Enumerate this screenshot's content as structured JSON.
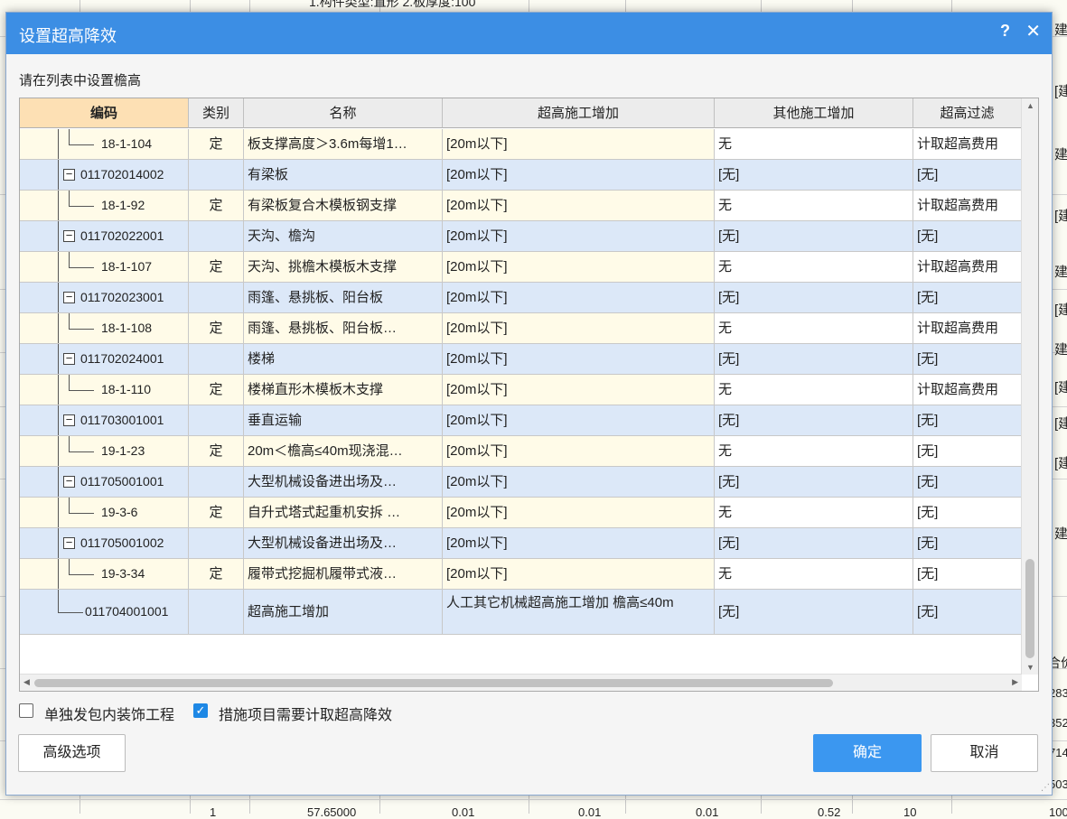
{
  "background": {
    "top_text": "1.构件类型:直形 2.板厚度:100",
    "right_column": [
      "建",
      "[建",
      "建",
      "[建",
      "建",
      "[建",
      "建",
      "[建",
      "[建",
      "[建",
      "建"
    ],
    "price_label": "合价",
    "price_values": [
      "283",
      "352",
      "714",
      "503",
      "100"
    ],
    "bottom_values": [
      "1",
      "57.65000",
      "0.01",
      "0.01",
      "0.01",
      "0.52",
      "10"
    ]
  },
  "dialog": {
    "title": "设置超高降效",
    "help_label": "?",
    "close_label": "✕",
    "instruction": "请在列表中设置檐高",
    "columns": [
      "编码",
      "类别",
      "名称",
      "超高施工增加",
      "其他施工增加",
      "超高过滤"
    ],
    "rows": [
      {
        "type": "quota",
        "code": "18-1-104",
        "category": "定",
        "name": "板支撑高度＞3.6m每增1…",
        "super": "[20m以下]",
        "other": "无",
        "filter": "计取超高费用"
      },
      {
        "type": "bill",
        "code": "011702014002",
        "category": "",
        "name": "有梁板",
        "super": "[20m以下]",
        "other": "[无]",
        "filter": "[无]"
      },
      {
        "type": "quota",
        "code": "18-1-92",
        "category": "定",
        "name": "有梁板复合木模板钢支撑",
        "super": "[20m以下]",
        "other": "无",
        "filter": "计取超高费用"
      },
      {
        "type": "bill",
        "code": "011702022001",
        "category": "",
        "name": "天沟、檐沟",
        "super": "[20m以下]",
        "other": "[无]",
        "filter": "[无]"
      },
      {
        "type": "quota",
        "code": "18-1-107",
        "category": "定",
        "name": "天沟、挑檐木模板木支撑",
        "super": "[20m以下]",
        "other": "无",
        "filter": "计取超高费用"
      },
      {
        "type": "bill",
        "code": "011702023001",
        "category": "",
        "name": "雨篷、悬挑板、阳台板",
        "super": "[20m以下]",
        "other": "[无]",
        "filter": "[无]"
      },
      {
        "type": "quota",
        "code": "18-1-108",
        "category": "定",
        "name": "雨篷、悬挑板、阳台板…",
        "super": "[20m以下]",
        "other": "无",
        "filter": "计取超高费用"
      },
      {
        "type": "bill",
        "code": "011702024001",
        "category": "",
        "name": "楼梯",
        "super": "[20m以下]",
        "other": "[无]",
        "filter": "[无]"
      },
      {
        "type": "quota",
        "code": "18-1-110",
        "category": "定",
        "name": "楼梯直形木模板木支撑",
        "super": "[20m以下]",
        "other": "无",
        "filter": "计取超高费用"
      },
      {
        "type": "bill",
        "code": "011703001001",
        "category": "",
        "name": "垂直运输",
        "super": "[20m以下]",
        "other": "[无]",
        "filter": "[无]"
      },
      {
        "type": "quota",
        "code": "19-1-23",
        "category": "定",
        "name": "20m＜檐高≤40m现浇混…",
        "super": "[20m以下]",
        "other": "无",
        "filter": "[无]"
      },
      {
        "type": "bill",
        "code": "011705001001",
        "category": "",
        "name": "大型机械设备进出场及…",
        "super": "[20m以下]",
        "other": "[无]",
        "filter": "[无]"
      },
      {
        "type": "quota",
        "code": "19-3-6",
        "category": "定",
        "name": "自升式塔式起重机安拆 …",
        "super": "[20m以下]",
        "other": "无",
        "filter": "[无]"
      },
      {
        "type": "bill",
        "code": "011705001002",
        "category": "",
        "name": "大型机械设备进出场及…",
        "super": "[20m以下]",
        "other": "[无]",
        "filter": "[无]"
      },
      {
        "type": "quota",
        "code": "19-3-34",
        "category": "定",
        "name": "履带式挖掘机履带式液…",
        "super": "[20m以下]",
        "other": "无",
        "filter": "[无]"
      },
      {
        "type": "leaf",
        "code": "011704001001",
        "category": "",
        "name": "超高施工增加",
        "super": "人工其它机械超高施工增加 檐高≤40m",
        "other": "[无]",
        "filter": "[无]"
      }
    ],
    "checkbox_separate": {
      "label": "单独发包内装饰工程",
      "checked": false
    },
    "checkbox_measure": {
      "label": "措施项目需要计取超高降效",
      "checked": true
    },
    "advanced_label": "高级选项",
    "ok_label": "确定",
    "cancel_label": "取消"
  }
}
